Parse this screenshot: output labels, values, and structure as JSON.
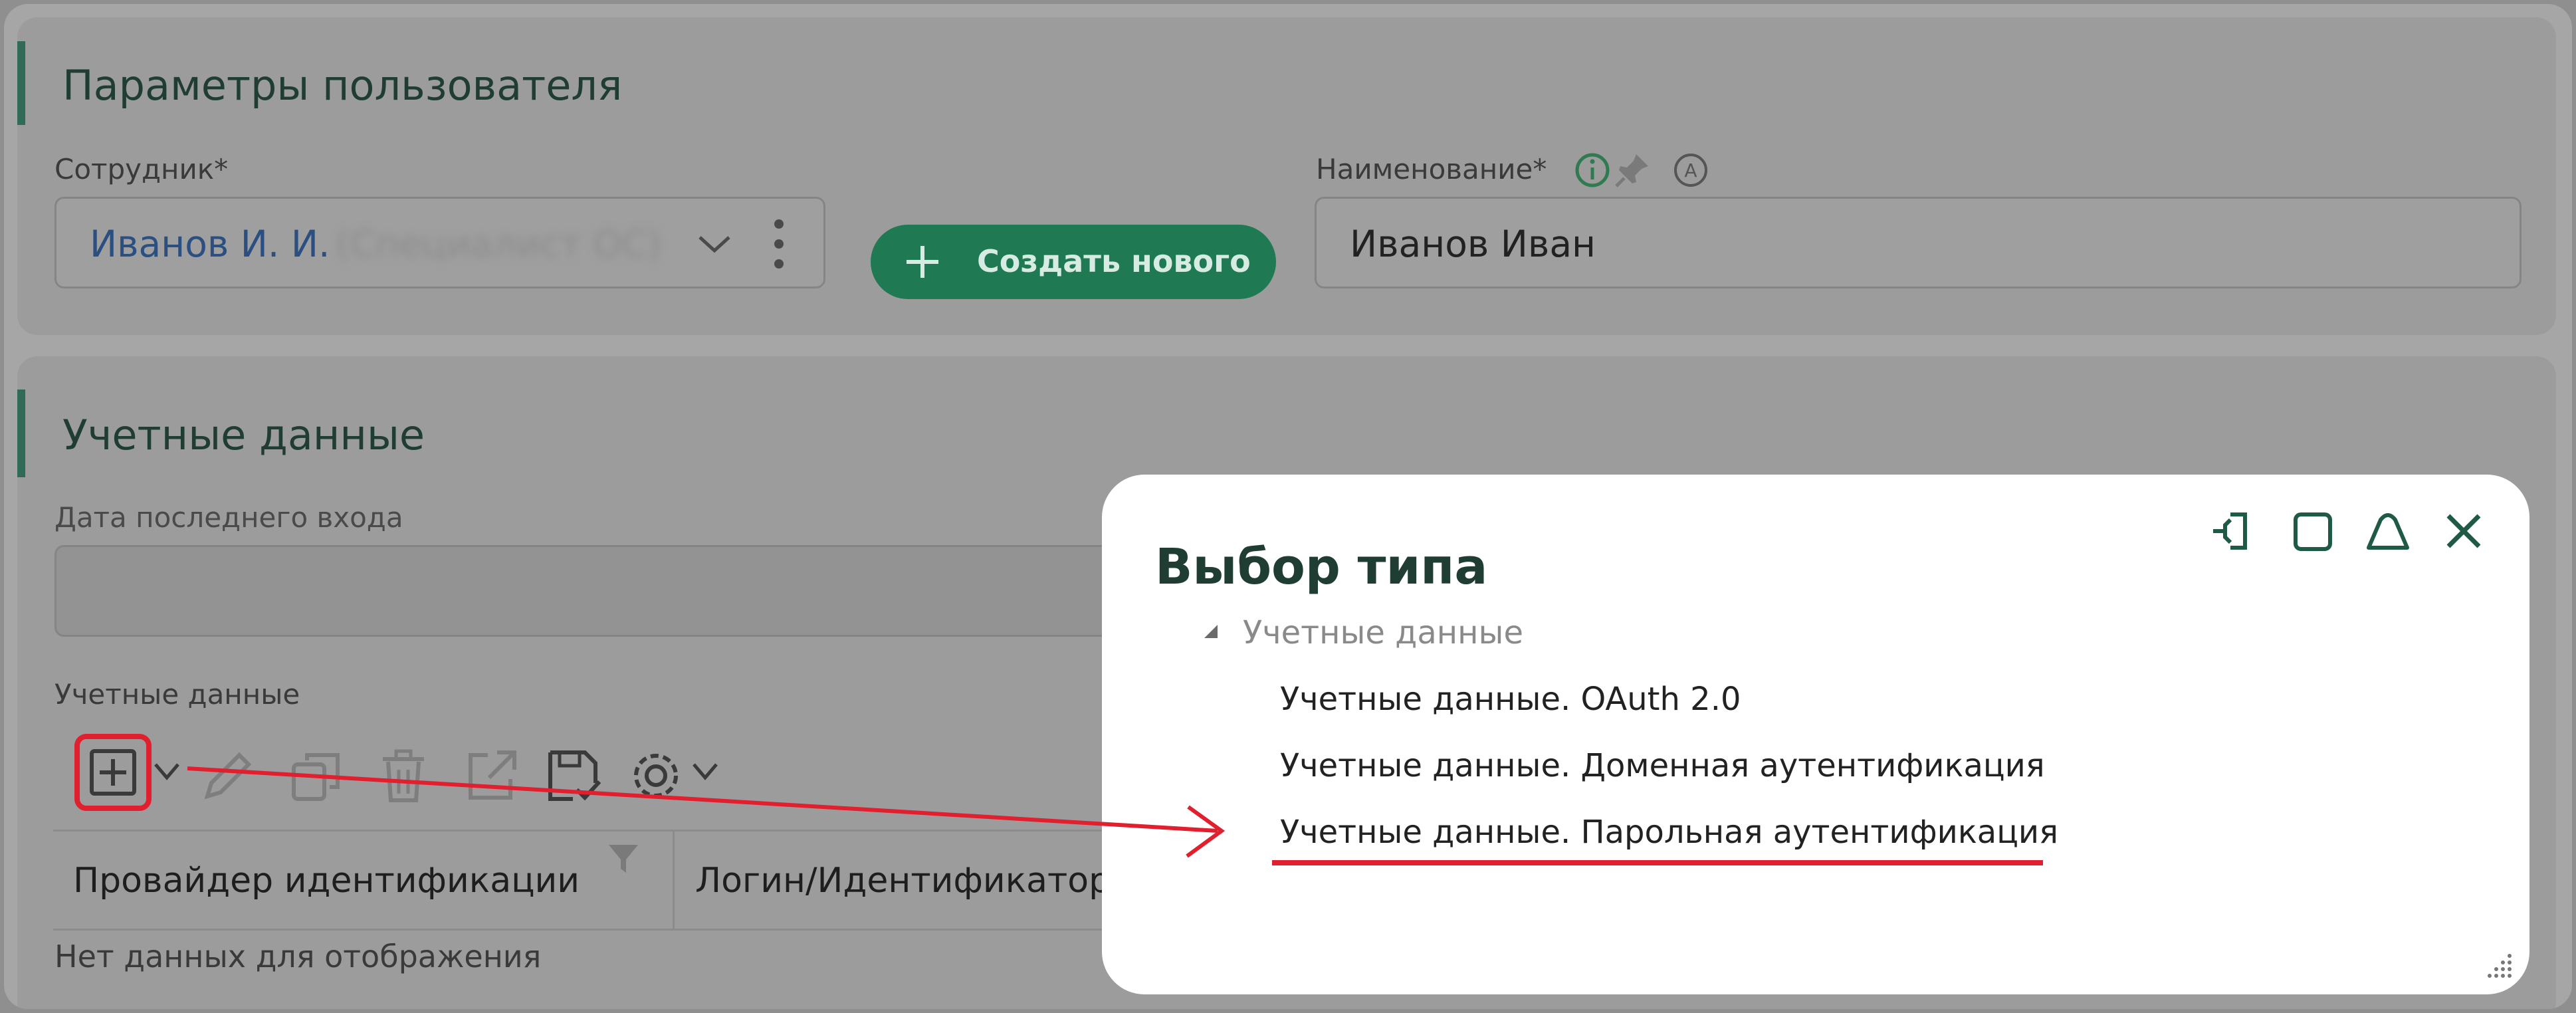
{
  "user_params": {
    "title": "Параметры пользователя",
    "employee_label": "Сотрудник",
    "employee_value": "Иванов И. И.",
    "employee_obscured": "(Специалист ОС)",
    "create_button_label": "Создать нового",
    "name_label": "Наименование",
    "name_value": "Иванов Иван",
    "required_mark": "*"
  },
  "credentials": {
    "title": "Учетные данные",
    "last_login_label": "Дата последнего входа",
    "last_login_value": "",
    "grid_label": "Учетные данные",
    "columns": [
      "Провайдер идентификации",
      "Логин/Идентификатор"
    ],
    "empty_text": "Нет данных для отображения"
  },
  "toolbar": {
    "icons": [
      "add-icon",
      "edit-icon",
      "copy-icon",
      "delete-icon",
      "open-external-icon",
      "save-check-icon",
      "settings-icon"
    ]
  },
  "dialog": {
    "title": "Выбор типа",
    "group": "Учетные данные",
    "items": [
      "Учетные данные. OAuth 2.0",
      "Учетные данные. Доменная аутентификация",
      "Учетные данные. Парольная аутентификация"
    ]
  },
  "colors": {
    "accent_green": "#1f7a54",
    "annotation_red": "#e0202e",
    "title_green": "#1f3d33"
  }
}
